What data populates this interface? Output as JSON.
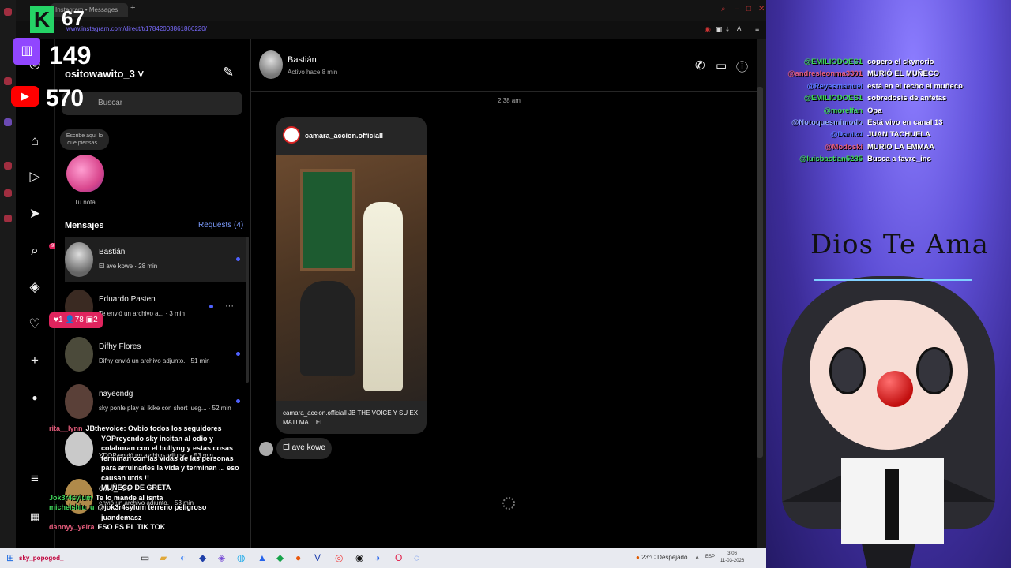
{
  "browser": {
    "tab_title": "Instagram • Messages",
    "url": "www.instagram.com/direct/t/17842003861866220/",
    "ai_label": "AI"
  },
  "overlays": {
    "kick_logo": "K",
    "kick_count": "67",
    "twitch_count": "149",
    "youtube_count": "570",
    "live_stats": "♥1  👤78  ▣2"
  },
  "inbox": {
    "username": "ositowawito_3",
    "search_placeholder": "Buscar",
    "note_text": "Escribe aquí lo que piensas...",
    "note_label": "Tu nota",
    "messages_heading": "Mensajes",
    "requests_label": "Requests (4)",
    "conversations": [
      {
        "name": "Bastián",
        "preview": "El ave kowe · 28 min"
      },
      {
        "name": "Eduardo Pasten",
        "preview": "Te envió un archivo a... · 3 min"
      },
      {
        "name": "Difhy Flores",
        "preview": "Difhy envió un archivo adjunto. · 51 min"
      },
      {
        "name": "nayecndg",
        "preview": "sky ponle play al ikike con short lueg... · 52 min"
      },
      {
        "name": "",
        "preview": "YDOP envió un archivo adjunto. · 53 min"
      },
      {
        "name": "cote_b10",
        "preview": "envió un archivo adjunto. · 53 min"
      }
    ],
    "nav_badge": "9+"
  },
  "chat": {
    "contact_name": "Bastián",
    "contact_status": "Activo hace 8 min",
    "time_separator": "2:38 am",
    "shared_post_user": "camara_accion.officiall",
    "shared_post_caption": "camara_accion.officiall JB THE VOICE Y SU EX MATI MATTEL",
    "last_message": "El ave kowe"
  },
  "overlay_chat": [
    {
      "user": "rita__lynn",
      "text": "JBthevoice: Ovbio todos los seguidores"
    },
    {
      "user": "",
      "text": "YOPreyendo sky incitan al odio y"
    },
    {
      "user": "",
      "text": "colaboran con el bullyng y estas cosas"
    },
    {
      "user": "",
      "text": "terminan con las vidas de las personas"
    },
    {
      "user": "",
      "text": "para arruinarles la vida y terminan ... eso"
    },
    {
      "user": "",
      "text": "causan utds !!"
    },
    {
      "user": "",
      "text": "MUÑECO DE GRETA"
    },
    {
      "user": "Jok3r4sylum",
      "text": "Te lo mande al isnta"
    },
    {
      "user": "michelshiu_u",
      "text": "@jok3r4sylum terreno peligroso"
    },
    {
      "user": "",
      "text": "juandemasz"
    },
    {
      "user": "dannyy_yeira",
      "text": "ESO ES EL TIK TOK"
    }
  ],
  "stream_chat": [
    {
      "user": "@EMILIODOES1",
      "text": "copero el skynorio"
    },
    {
      "user": "@andresleonma3301",
      "text": "MURIÓ EL MUÑECO"
    },
    {
      "user": "@Reyesmanuel",
      "text": "está en el techo el muñeco"
    },
    {
      "user": "@EMILIODOES1",
      "text": "sobredosis de anfetas"
    },
    {
      "user": "@morelfan",
      "text": "Opa"
    },
    {
      "user": "@Notoquesmimodo",
      "text": "Está vivo en canal 13"
    },
    {
      "user": "@Danixd",
      "text": "JUAN TACHUELA"
    },
    {
      "user": "@Modoski",
      "text": "MURIO LA EMMAA"
    },
    {
      "user": "@luisbastian5285",
      "text": "Busca a favre_inc"
    }
  ],
  "vtuber": {
    "title": "Dios Te Ama"
  },
  "taskbar": {
    "user_label": "sky_popogod_",
    "weather": "23°C Despejado",
    "lang": "ESP",
    "time": "3:06",
    "date": "11-03-2026"
  },
  "colors": {
    "accent_blue": "#4f62ff",
    "kick_green": "#25d366",
    "twitch_purple": "#9146ff",
    "youtube_red": "#ff0000"
  }
}
